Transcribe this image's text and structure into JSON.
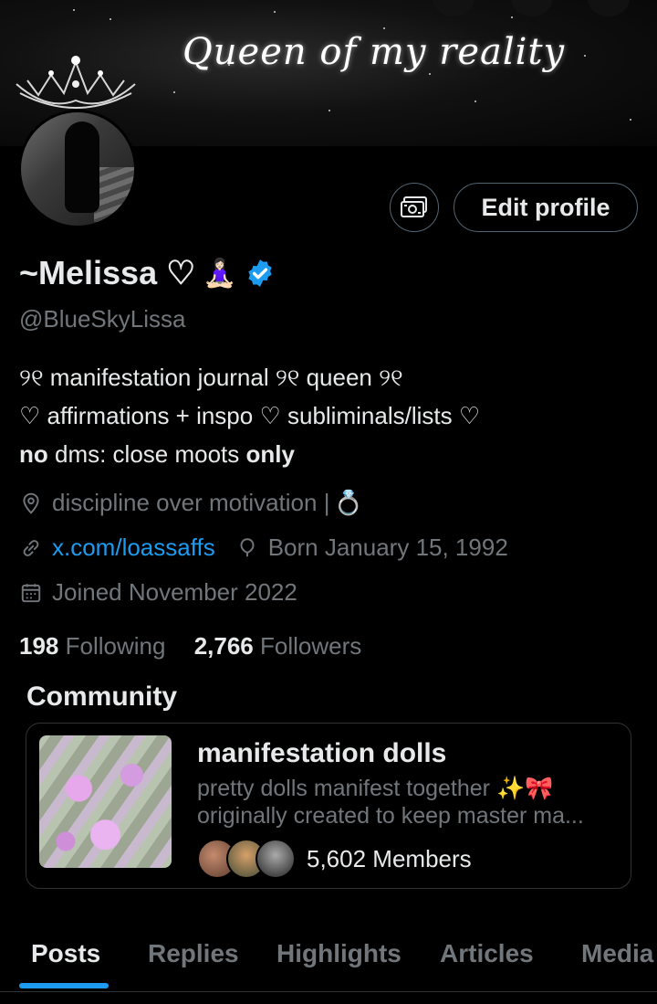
{
  "banner": {
    "title": "Queen of my reality"
  },
  "profile": {
    "display_name": "~Melissa ♡",
    "emoji": "🧘🏻‍♀️",
    "handle": "@BlueSkyLissa",
    "edit_label": "Edit profile"
  },
  "bio": {
    "line1": "୨୧ manifestation journal ୨୧ queen ୨୧",
    "line2": "♡ affirmations + inspo ♡ subliminals/lists ♡",
    "line3_a": "no",
    "line3_b": " dms: close moots ",
    "line3_c": "only"
  },
  "meta": {
    "location": "discipline over motivation |",
    "location_emoji": "💍",
    "link": "x.com/loassaffs",
    "birthday": "Born January 15, 1992",
    "joined": "Joined November 2022"
  },
  "stats": {
    "following_count": "198",
    "following_label": "Following",
    "followers_count": "2,766",
    "followers_label": "Followers"
  },
  "community": {
    "section_title": "Community",
    "name": "manifestation dolls",
    "desc_line1": "pretty dolls manifest together ✨🎀",
    "desc_line2": "originally created to keep master ma...",
    "members": "5,602 Members"
  },
  "tabs": [
    {
      "label": "Posts"
    },
    {
      "label": "Replies"
    },
    {
      "label": "Highlights"
    },
    {
      "label": "Articles"
    },
    {
      "label": "Media"
    }
  ],
  "colors": {
    "accent": "#1d9bf0",
    "muted": "#71767b",
    "text": "#e7e9ea",
    "verified": "#1d9bf0"
  }
}
